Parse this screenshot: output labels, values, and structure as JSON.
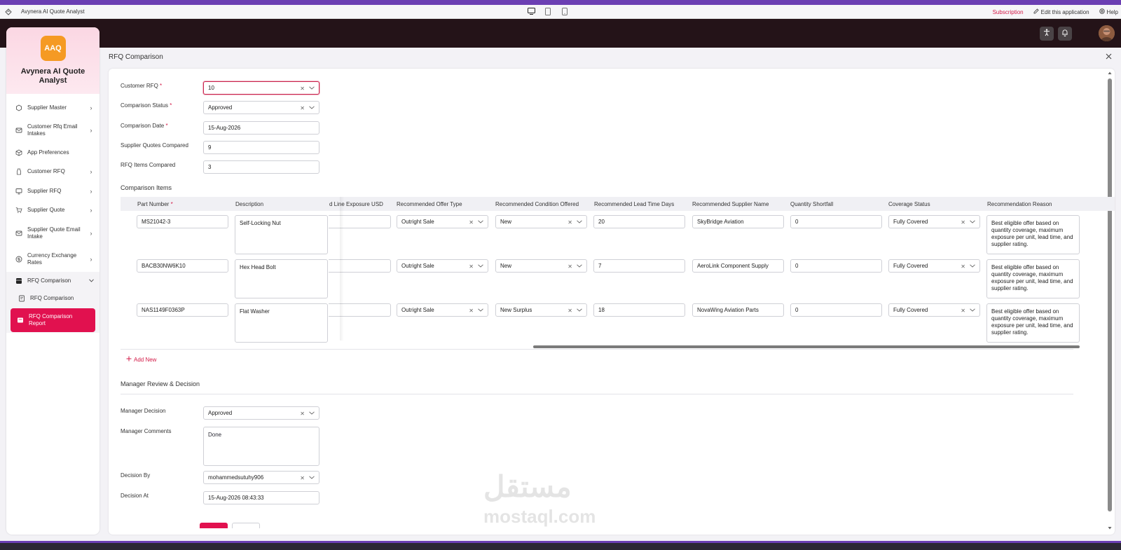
{
  "app": {
    "window_title": "Avynera AI Quote Analyst",
    "subscription_label": "Subscription",
    "edit_label": "Edit this application",
    "help_label": "Help"
  },
  "sidebar": {
    "logo_text": "AAQ",
    "brand_name": "Avynera AI Quote Analyst",
    "items": [
      {
        "label": "Supplier Master",
        "icon": "hexagon-icon"
      },
      {
        "label": "Customer Rfq Email Intakes",
        "icon": "mail-icon"
      },
      {
        "label": "App Preferences",
        "icon": "cube-icon"
      },
      {
        "label": "Customer RFQ",
        "icon": "tag-icon"
      },
      {
        "label": "Supplier RFQ",
        "icon": "monitor-icon"
      },
      {
        "label": "Supplier Quote",
        "icon": "cart-icon"
      },
      {
        "label": "Supplier Quote Email Intake",
        "icon": "mail-icon"
      },
      {
        "label": "Currency Exchange Rates",
        "icon": "coin-icon"
      },
      {
        "label": "RFQ Comparison",
        "icon": "box-icon"
      },
      {
        "label": "RFQ Comparison",
        "icon": "doc-icon"
      },
      {
        "label": "RFQ Comparison Report",
        "icon": "report-icon"
      }
    ]
  },
  "page": {
    "title": "RFQ Comparison"
  },
  "form": {
    "customer_rfq_label": "Customer RFQ",
    "customer_rfq_value": "10",
    "status_label": "Comparison Status",
    "status_value": "Approved",
    "date_label": "Comparison Date",
    "date_value": "15-Aug-2026",
    "quotes_label": "Supplier Quotes Compared",
    "quotes_value": "9",
    "items_label": "RFQ Items Compared",
    "items_value": "3",
    "required_mark": "*"
  },
  "items_section": {
    "title": "Comparison Items",
    "add_new": "Add New",
    "columns": [
      "Part Number",
      "Description",
      "d Line Exposure USD",
      "Recommended Offer Type",
      "Recommended Condition Offered",
      "Recommended Lead Time Days",
      "Recommended Supplier Name",
      "Quantity Shortfall",
      "Coverage Status",
      "Recommendation Reason"
    ],
    "rows": [
      {
        "part_number": "MS21042-3",
        "description": "Self-Locking Nut",
        "exposure": "",
        "offer_type": "Outright Sale",
        "condition": "New",
        "lead_time": "20",
        "supplier": "SkyBridge Aviation",
        "shortfall": "0",
        "coverage": "Fully Covered",
        "reason": "Best eligible offer based on quantity coverage, maximum exposure per unit, lead time, and supplier rating."
      },
      {
        "part_number": "BACB30NW6K10",
        "description": "Hex Head Bolt",
        "exposure": "",
        "offer_type": "Outright Sale",
        "condition": "New",
        "lead_time": "7",
        "supplier": "AeroLink Component Supply",
        "shortfall": "0",
        "coverage": "Fully Covered",
        "reason": "Best eligible offer based on quantity coverage, maximum exposure per unit, lead time, and supplier rating."
      },
      {
        "part_number": "NAS1149F0363P",
        "description": "Flat Washer",
        "exposure": "",
        "offer_type": "Outright Sale",
        "condition": "New Surplus",
        "lead_time": "18",
        "supplier": "NovaWing Aviation Parts",
        "shortfall": "0",
        "coverage": "Fully Covered",
        "reason": "Best eligible offer based on quantity coverage, maximum exposure per unit, lead time, and supplier rating."
      }
    ]
  },
  "manager": {
    "title": "Manager Review & Decision",
    "decision_label": "Manager Decision",
    "decision_value": "Approved",
    "comments_label": "Manager Comments",
    "comments_value": "Done",
    "decision_by_label": "Decision By",
    "decision_by_value": "mohammedsutuhy906",
    "decision_at_label": "Decision At",
    "decision_at_value": "15-Aug-2026 08:43:33"
  },
  "watermark": {
    "arabic": "مستقل",
    "latin": "mostaql.com"
  },
  "colors": {
    "accent": "#e1114f",
    "logo": "#f59a23",
    "topbar": "#241318"
  }
}
